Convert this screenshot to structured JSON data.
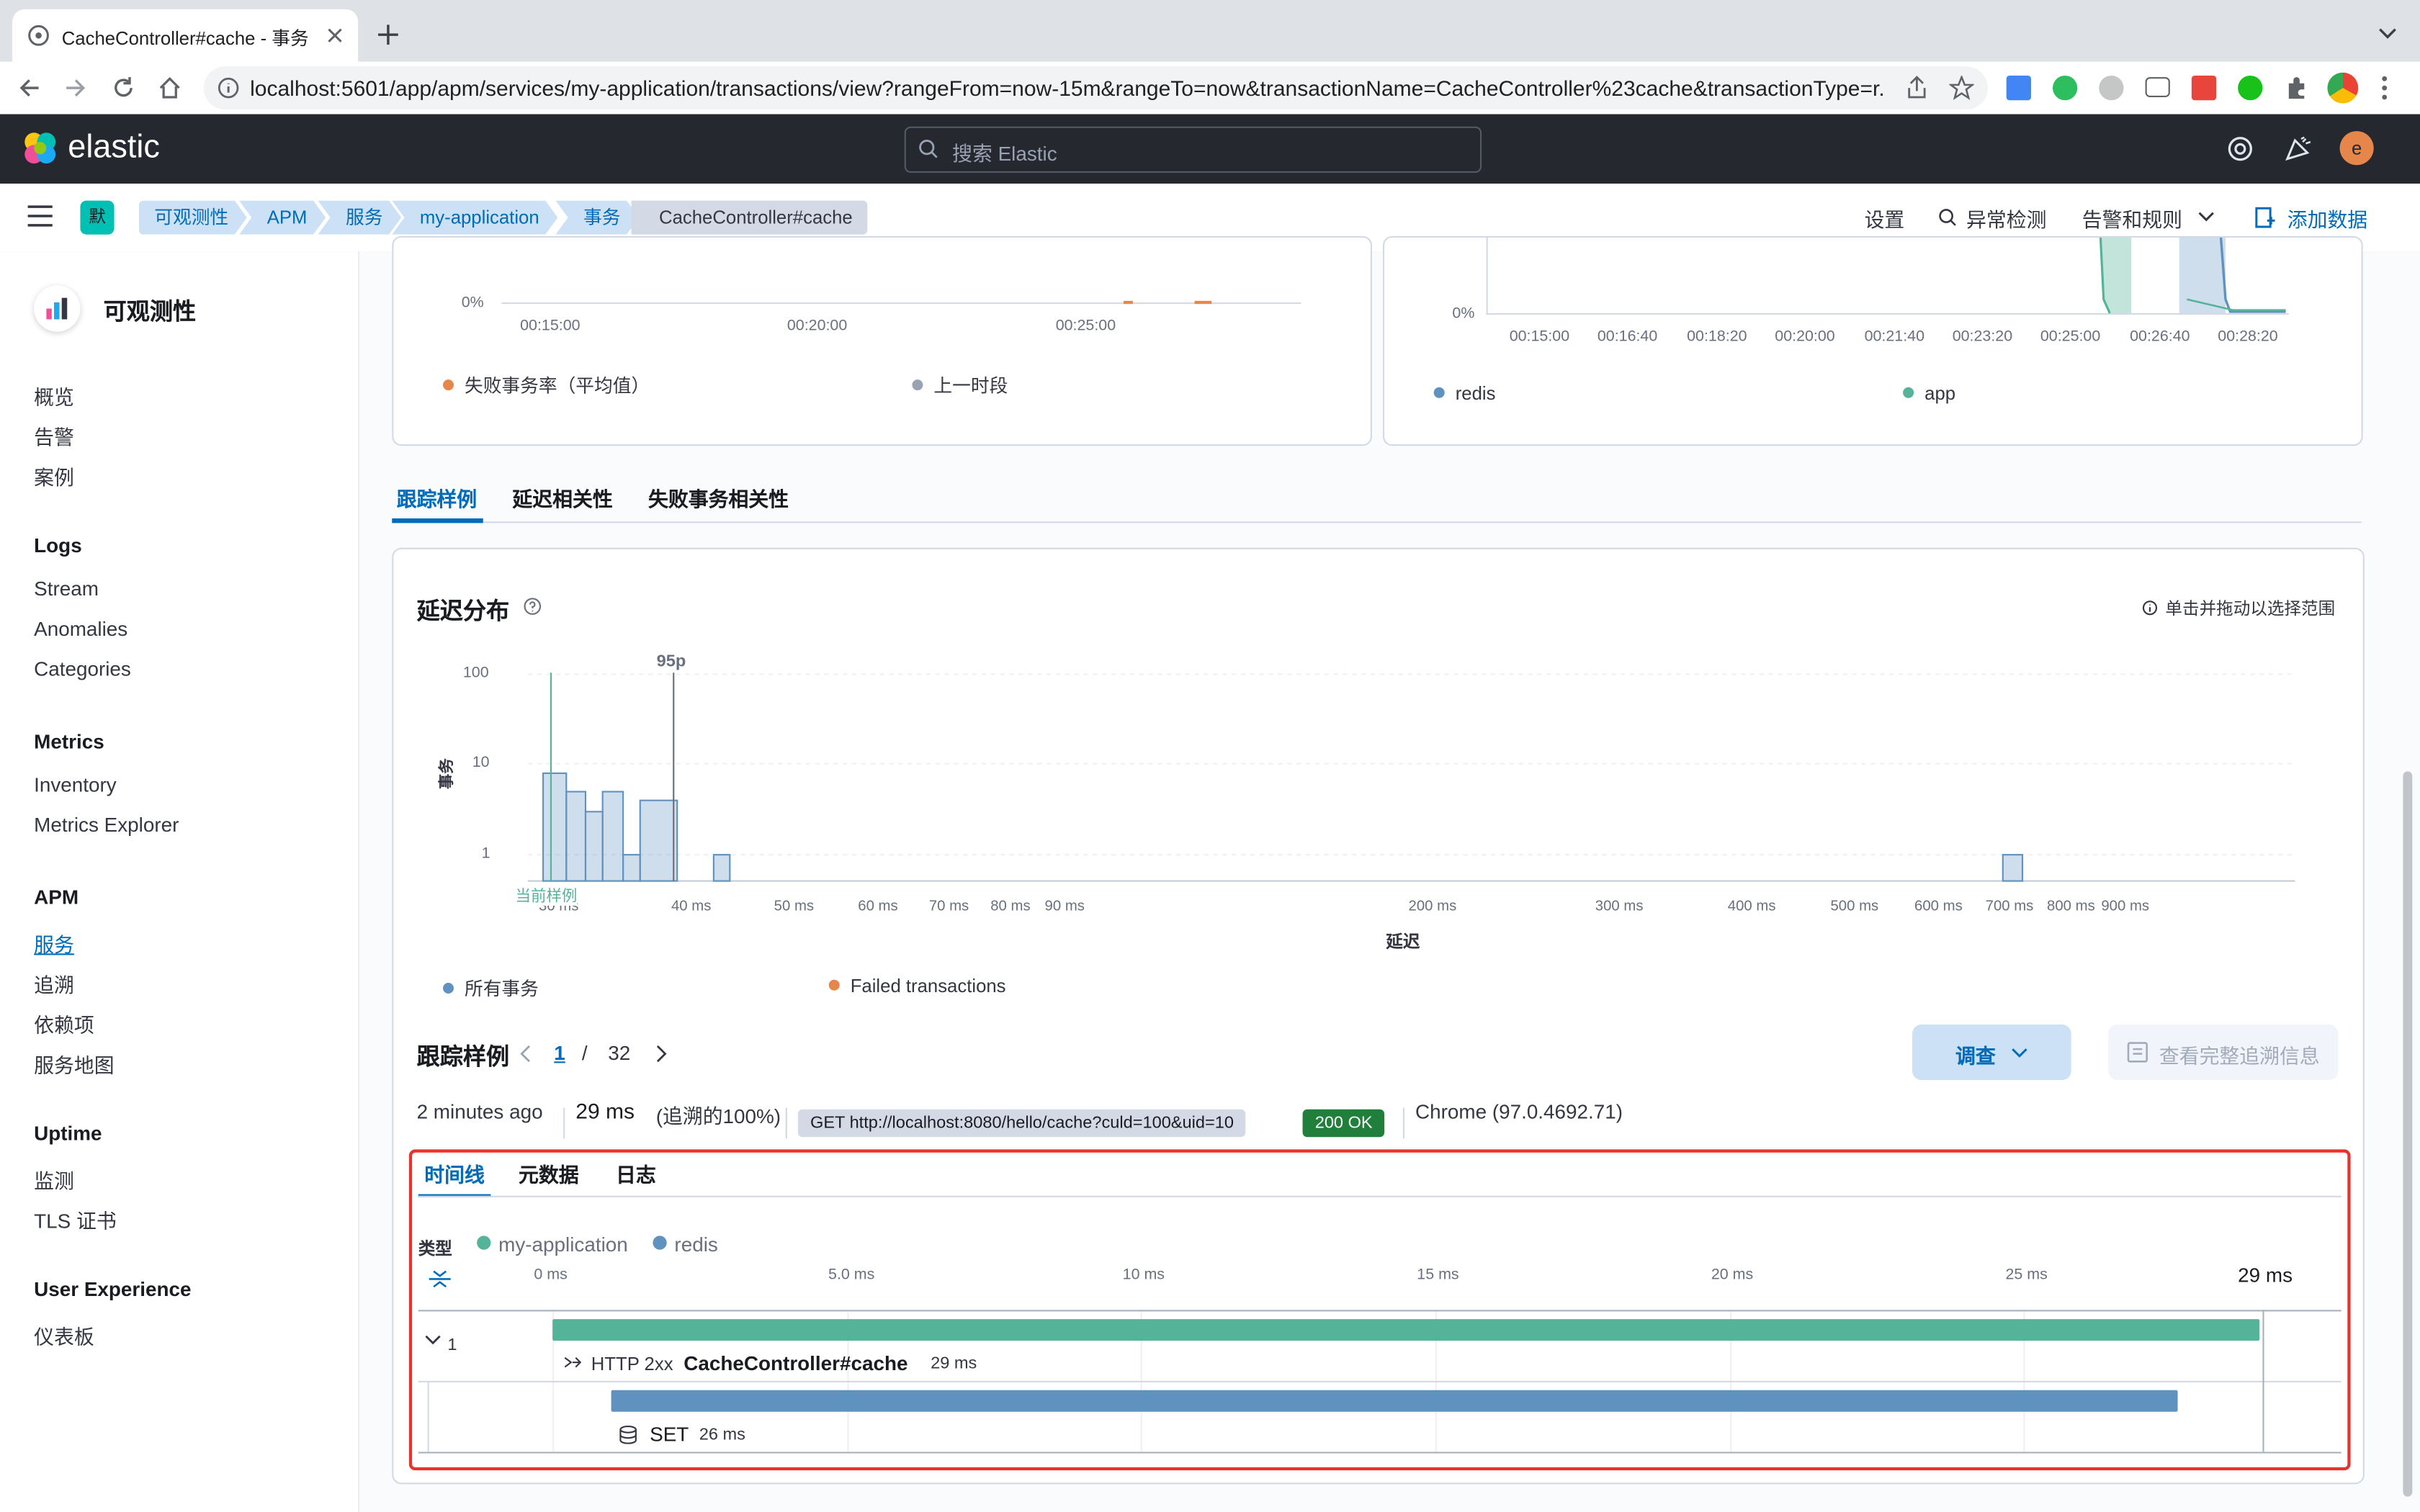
{
  "browser": {
    "tab_title": "CacheController#cache - 事务",
    "url": "localhost:5601/app/apm/services/my-application/transactions/view?rangeFrom=now-15m&rangeTo=now&transactionName=CacheController%23cache&transactionType=r..."
  },
  "header": {
    "logo_text": "elastic",
    "search_placeholder": "搜索 Elastic",
    "avatar_letter": "e"
  },
  "breadcrumbs": {
    "space": "默",
    "items": [
      "可观测性",
      "APM",
      "服务",
      "my-application",
      "事务",
      "CacheController#cache"
    ],
    "settings": "设置",
    "anomaly": "异常检测",
    "alerts": "告警和规则",
    "add_data": "添加数据"
  },
  "sidebar": {
    "title": "可观测性",
    "top_items": [
      "概览",
      "告警",
      "案例"
    ],
    "sections": [
      {
        "title": "Logs",
        "items": [
          "Stream",
          "Anomalies",
          "Categories"
        ]
      },
      {
        "title": "Metrics",
        "items": [
          "Inventory",
          "Metrics Explorer"
        ]
      },
      {
        "title": "APM",
        "items": [
          "服务",
          "追溯",
          "依赖项",
          "服务地图"
        ]
      },
      {
        "title": "Uptime",
        "items": [
          "监测",
          "TLS 证书"
        ]
      },
      {
        "title": "User Experience",
        "items": [
          "仪表板"
        ]
      }
    ],
    "active": "服务"
  },
  "top_left_chart": {
    "y_zero": "0%",
    "x_ticks": [
      "00:15:00",
      "00:20:00",
      "00:25:00"
    ],
    "legend": [
      "失败事务率（平均值）",
      "上一时段"
    ],
    "colors": [
      "#e7864b",
      "#98a2b3"
    ]
  },
  "top_right_chart": {
    "y_zero": "0%",
    "x_ticks": [
      "00:15:00",
      "00:16:40",
      "00:18:20",
      "00:20:00",
      "00:21:40",
      "00:23:20",
      "00:25:00",
      "00:26:40",
      "00:28:20"
    ],
    "legend": [
      "redis",
      "app"
    ],
    "colors": [
      "#6092c0",
      "#54b399"
    ]
  },
  "tabs": [
    "跟踪样例",
    "延迟相关性",
    "失败事务相关性"
  ],
  "latency": {
    "title": "延迟分布",
    "hint": "单击并拖动以选择范围",
    "ylabel": "事务",
    "xlabel": "延迟",
    "p95_label": "95p",
    "current_sample": "当前样例",
    "legend": [
      "所有事务",
      "Failed transactions"
    ],
    "legend_colors": [
      "#6092c0",
      "#e7864b"
    ]
  },
  "chart_data": {
    "type": "bar",
    "title": "延迟分布",
    "xlabel": "延迟",
    "ylabel": "事务",
    "x_scale": "log",
    "y_scale": "log",
    "y_ticks": [
      "1",
      "10",
      "100"
    ],
    "x_ticks": [
      "30 ms",
      "40 ms",
      "50 ms",
      "60 ms",
      "70 ms",
      "80 ms",
      "90 ms",
      "200 ms",
      "300 ms",
      "400 ms",
      "500 ms",
      "600 ms",
      "700 ms",
      "800 ms",
      "900 ms"
    ],
    "x_tick_values": [
      30,
      40,
      50,
      60,
      70,
      80,
      90,
      200,
      300,
      400,
      500,
      600,
      700,
      800,
      900
    ],
    "series": [
      {
        "name": "所有事务",
        "bins": [
          {
            "from": 29,
            "to": 30.5,
            "count": 8
          },
          {
            "from": 30.5,
            "to": 31.8,
            "count": 5
          },
          {
            "from": 31.8,
            "to": 33,
            "count": 3
          },
          {
            "from": 33,
            "to": 34.5,
            "count": 5
          },
          {
            "from": 34.5,
            "to": 35.8,
            "count": 1
          },
          {
            "from": 35.8,
            "to": 38.8,
            "count": 4
          },
          {
            "from": 42,
            "to": 43.5,
            "count": 1
          },
          {
            "from": 690,
            "to": 720,
            "count": 1
          }
        ]
      }
    ],
    "markers": {
      "p95": 38.5,
      "current_sample": 29.5
    }
  },
  "samples": {
    "title": "跟踪样例",
    "page": "1",
    "sep": "/",
    "total": "32",
    "investigate": "调查",
    "full_trace": "查看完整追溯信息",
    "time_ago": "2 minutes ago",
    "duration": "29 ms",
    "duration_pct": "(追溯的100%)",
    "request": "GET http://localhost:8080/hello/cache?culd=100&uid=10",
    "status": "200 OK",
    "agent": "Chrome (97.0.4692.71)"
  },
  "waterfall": {
    "tabs": [
      "时间线",
      "元数据",
      "日志"
    ],
    "type_label": "类型",
    "services": [
      {
        "name": "my-application",
        "color": "#54b399"
      },
      {
        "name": "redis",
        "color": "#6092c0"
      }
    ],
    "axis_ticks": [
      "0 ms",
      "5.0 ms",
      "10 ms",
      "15 ms",
      "20 ms",
      "25 ms"
    ],
    "axis_tick_values": [
      0,
      5,
      10,
      15,
      20,
      25
    ],
    "total_label": "29 ms",
    "total_ms": 29,
    "highlight_color": "#e7332b",
    "rows": [
      {
        "count": "1",
        "http": "HTTP 2xx",
        "name": "CacheController#cache",
        "duration": "29 ms",
        "start_ms": 0,
        "dur_ms": 29,
        "color": "#54b399"
      },
      {
        "name": "SET",
        "duration": "26 ms",
        "start_ms": 1,
        "dur_ms": 26.6,
        "color": "#6092c0"
      }
    ]
  }
}
